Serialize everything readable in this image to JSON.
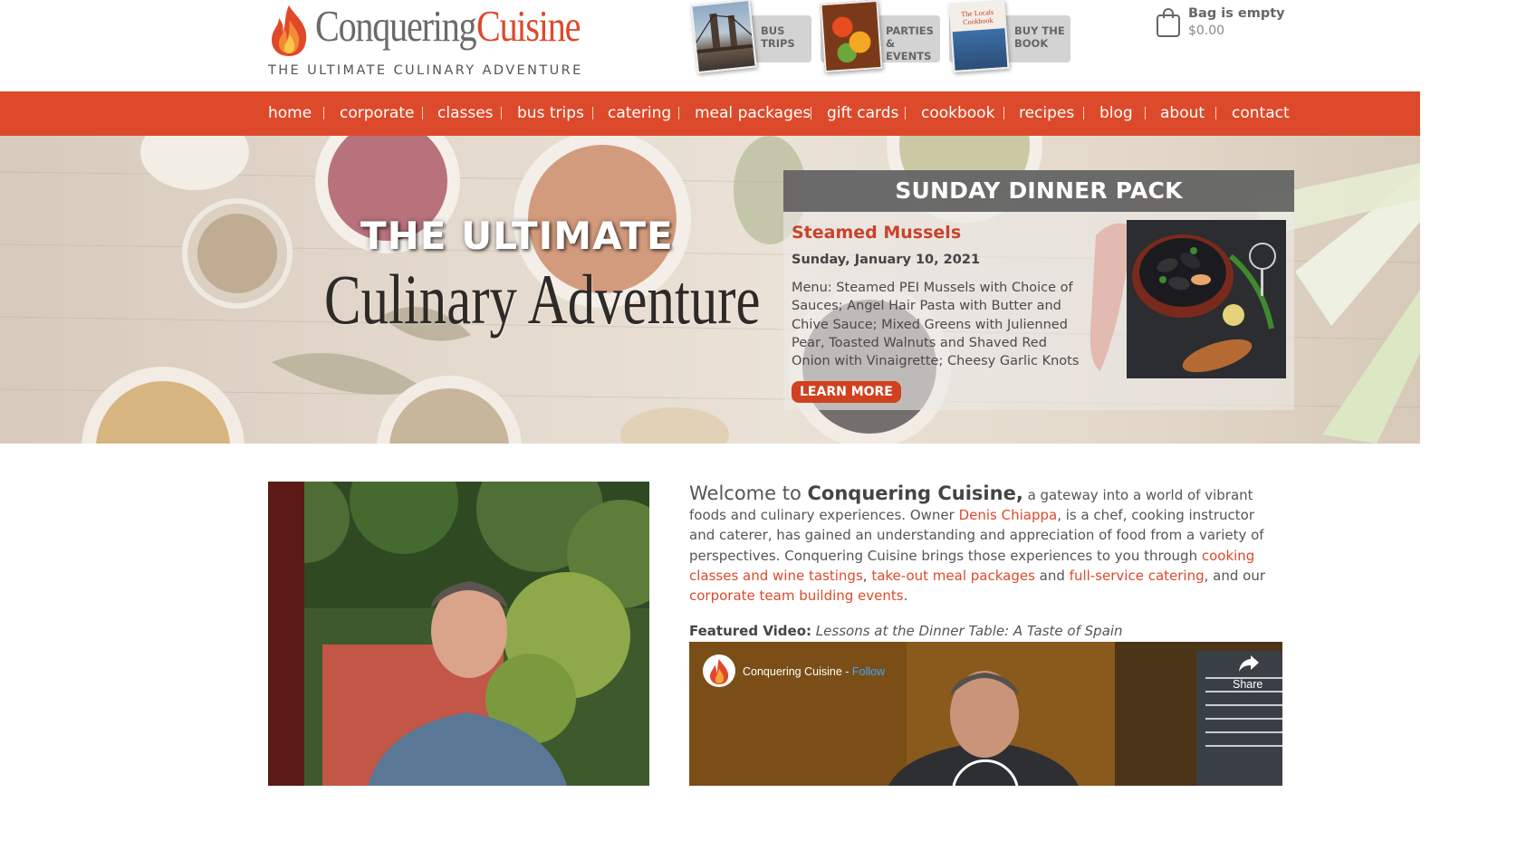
{
  "brand": {
    "name_part1": "Conquering",
    "name_part2": "Cuisine",
    "tagline": "THE ULTIMATE CULINARY ADVENTURE"
  },
  "promos": [
    {
      "label_line1": "BUS",
      "label_line2": "TRIPS",
      "icon": "bridge-photo"
    },
    {
      "label_line1": "PARTIES",
      "label_line2": "& EVENTS",
      "icon": "food-photo"
    },
    {
      "label_line1": "BUY THE",
      "label_line2": "BOOK",
      "icon": "cookbook-cover"
    }
  ],
  "cookbook_cover_text": "The Locals Cookbook",
  "cart": {
    "title": "Bag is empty",
    "total": "$0.00",
    "icon": "shopping-bag-icon"
  },
  "nav": [
    "home",
    "corporate",
    "classes",
    "bus trips",
    "catering",
    "meal packages",
    "gift cards",
    "cookbook",
    "recipes",
    "blog",
    "about",
    "contact"
  ],
  "hero": {
    "line1": "THE ULTIMATE",
    "line2": "Culinary Adventure"
  },
  "dinner": {
    "heading": "SUNDAY DINNER PACK",
    "title": "Steamed Mussels",
    "date": "Sunday, January 10, 2021",
    "menu": "Menu: Steamed PEI Mussels with Choice of Sauces; Angel Hair Pasta with Butter and Chive Sauce; Mixed Greens with Julienned Pear, Toasted Walnuts and Shaved Red Onion with Vinaigrette; Cheesy Garlic Knots",
    "button": "LEARN MORE"
  },
  "welcome": {
    "lead": "Welcome to ",
    "brand": "Conquering Cuisine,",
    "t1": " a gateway into a world of vibrant foods and culinary experiences. Owner ",
    "owner_link": "Denis Chiappa",
    "t2": ", is a chef, cooking instructor and caterer, has gained an understanding and appreciation of food from a variety of perspectives. Conquering Cuisine brings those experiences to you through ",
    "link_classes": "cooking classes and wine tastings",
    "t3": ", ",
    "link_meals": "take-out meal packages",
    "t4": " and ",
    "link_catering": "full-service catering",
    "t5": ", and our ",
    "link_corporate": "corporate team building events",
    "t6": "."
  },
  "featured": {
    "label": "Featured Video:",
    "title": "Lessons at the Dinner Table: A Taste of Spain"
  },
  "video": {
    "channel": "Conquering Cuisine - ",
    "follow": "Follow",
    "share": "Share"
  },
  "colors": {
    "accent": "#dd4a2b",
    "nav_bg": "#dd4a2b",
    "dinner_header": "#5f5f5f"
  }
}
